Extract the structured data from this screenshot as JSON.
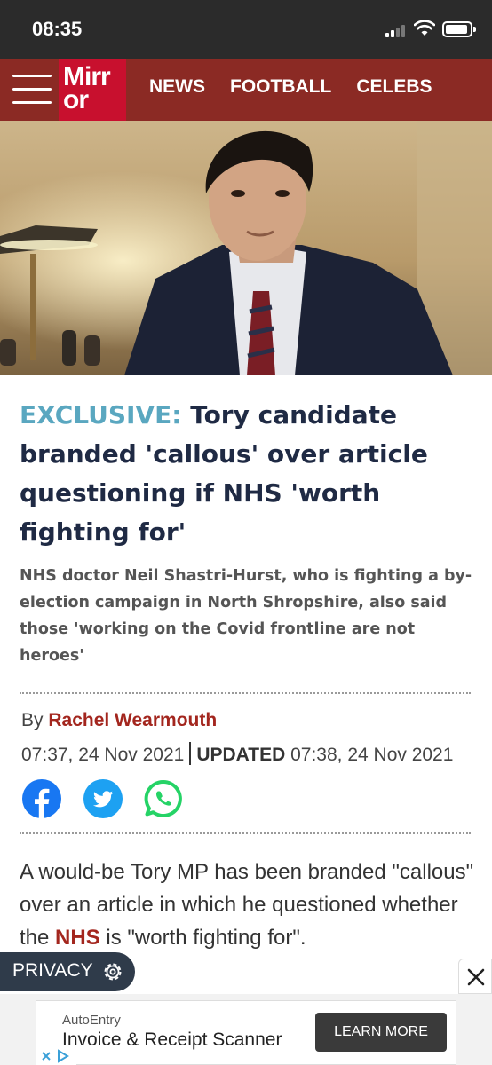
{
  "status_bar": {
    "time": "08:35"
  },
  "nav": {
    "logo_line1": "Mirr",
    "logo_line2": "or",
    "links": [
      "NEWS",
      "FOOTBALL",
      "CELEBS"
    ]
  },
  "hero": {
    "icon": "photo-of-man-in-suit"
  },
  "article": {
    "kicker": "EXCLUSIVE:",
    "headline": "Tory candidate branded 'callous' over article questioning if NHS 'worth fighting for'",
    "standfirst": "NHS doctor Neil Shastri-Hurst, who is fighting a by-election campaign in North Shropshire, also said those 'working on the Covid frontline are not heroes'",
    "byline_prefix": "By",
    "author": "Rachel Wearmouth",
    "published": "07:37, 24 Nov 2021",
    "updated_label": "UPDATED",
    "updated": "07:38, 24 Nov 2021",
    "share_icons": [
      "facebook-icon",
      "twitter-icon",
      "whatsapp-icon"
    ],
    "body_before": "A would-be Tory MP has been branded \"callous\" over an article in which he questioned whether the",
    "body_link": "NHS",
    "body_after": "is \"worth fighting for\"."
  },
  "privacy": {
    "label": "PRIVACY"
  },
  "ad": {
    "brand": "AutoEntry",
    "title": "Invoice & Receipt Scanner",
    "cta": "LEARN MORE"
  },
  "colors": {
    "nav_bg": "#8b2a24",
    "logo_bg": "#c8102e",
    "kicker": "#5aa7c0",
    "author": "#a3261e",
    "facebook": "#1877f2",
    "twitter": "#1da1f2",
    "whatsapp": "#25d366"
  }
}
